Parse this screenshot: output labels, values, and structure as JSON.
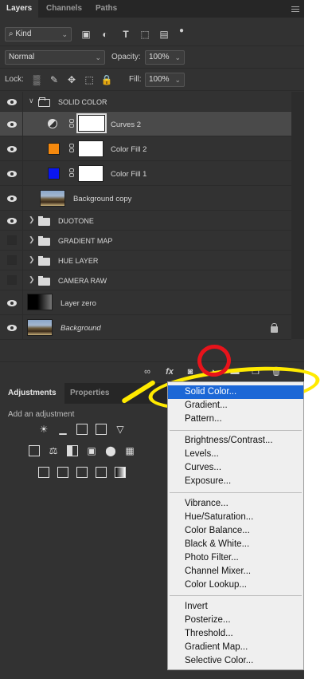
{
  "tabs": {
    "layers": "Layers",
    "channels": "Channels",
    "paths": "Paths"
  },
  "filter": {
    "kind_label": "Kind"
  },
  "blend": {
    "mode": "Normal",
    "opacity_label": "Opacity:",
    "opacity_value": "100%"
  },
  "lock": {
    "label": "Lock:",
    "fill_label": "Fill:",
    "fill_value": "100%"
  },
  "layers": [
    {
      "name": "SOLID COLOR",
      "type": "group-open",
      "visible": true
    },
    {
      "name": "Curves 2",
      "type": "adjustment",
      "visible": true,
      "selected": true
    },
    {
      "name": "Color Fill 2",
      "type": "fill",
      "color": "#f5890e",
      "visible": true
    },
    {
      "name": "Color Fill 1",
      "type": "fill",
      "color": "#0a16f0",
      "visible": true
    },
    {
      "name": "Background copy",
      "type": "image",
      "visible": true
    },
    {
      "name": "DUOTONE",
      "type": "group",
      "visible": true
    },
    {
      "name": "GRADIENT MAP",
      "type": "group",
      "visible": false
    },
    {
      "name": "HUE LAYER",
      "type": "group",
      "visible": false
    },
    {
      "name": "CAMERA RAW",
      "type": "group",
      "visible": false
    },
    {
      "name": "Layer zero",
      "type": "smart-object",
      "visible": true
    },
    {
      "name": "Background",
      "type": "background",
      "visible": true,
      "locked": true
    }
  ],
  "bottom_icons": [
    "link-icon",
    "fx-icon",
    "add-mask-icon",
    "new-adjustment-icon",
    "new-group-icon",
    "new-layer-icon",
    "trash-icon"
  ],
  "adjustments_panel": {
    "tab_adjustments": "Adjustments",
    "tab_properties": "Properties",
    "hint": "Add an adjustment"
  },
  "menu": {
    "group1": [
      "Solid Color...",
      "Gradient...",
      "Pattern..."
    ],
    "group2": [
      "Brightness/Contrast...",
      "Levels...",
      "Curves...",
      "Exposure..."
    ],
    "group3": [
      "Vibrance...",
      "Hue/Saturation...",
      "Color Balance...",
      "Black & White...",
      "Photo Filter...",
      "Channel Mixer...",
      "Color Lookup..."
    ],
    "group4": [
      "Invert",
      "Posterize...",
      "Threshold...",
      "Gradient Map...",
      "Selective Color..."
    ]
  },
  "colors": {
    "panel_bg": "#323232",
    "highlight": "#1c67d6",
    "annotation_red": "#e8131b",
    "annotation_yellow": "#ffea00"
  }
}
